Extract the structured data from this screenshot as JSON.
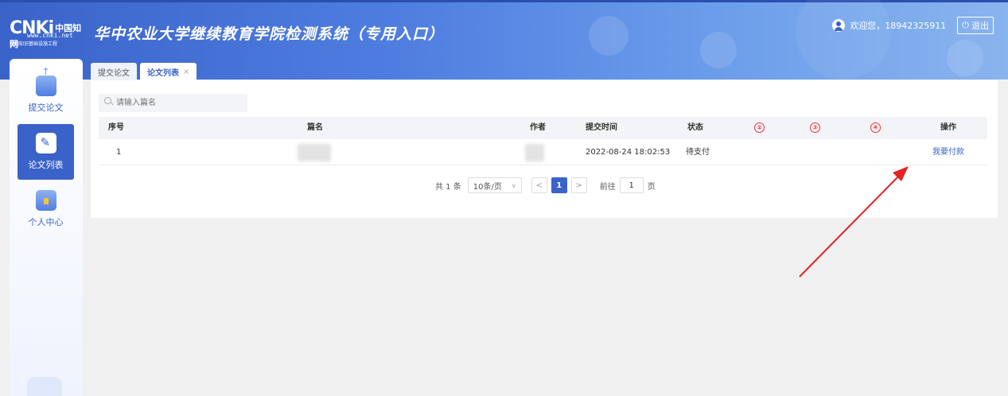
{
  "header": {
    "logo_big": "CNKi",
    "logo_cn": "中国知网",
    "logo_url": "www.cnki.net",
    "logo_sub": "中国知识基础设施工程",
    "title": "华中农业大学继续教育学院检测系统（专用入口）",
    "welcome": "欢迎您，18942325911",
    "logout_label": "退出"
  },
  "sidebar": {
    "items": [
      {
        "label": "提交论文",
        "icon": "upload-icon"
      },
      {
        "label": "论文列表",
        "icon": "edit-icon"
      },
      {
        "label": "个人中心",
        "icon": "user-center-icon"
      }
    ]
  },
  "tabs": [
    {
      "label": "提交论文"
    },
    {
      "label": "论文列表",
      "close": "×"
    }
  ],
  "search": {
    "placeholder": "请输入篇名"
  },
  "table": {
    "columns": [
      "序号",
      "篇名",
      "作者",
      "提交时间",
      "状态",
      "②",
      "③",
      "④",
      "操作"
    ],
    "rows": [
      {
        "index": "1",
        "title": "",
        "author": "",
        "submit_time": "2022-08-24 18:02:53",
        "status": "待支付",
        "action": "我要付款"
      }
    ]
  },
  "pagination": {
    "total": "共 1 条",
    "page_size": "10条/页",
    "prev": "<",
    "current_page": "1",
    "next": ">",
    "goto_prefix": "前往",
    "goto_value": "1",
    "goto_suffix": "页"
  },
  "colors": {
    "primary": "#3a63c9",
    "annotation_arrow": "#e32222"
  }
}
